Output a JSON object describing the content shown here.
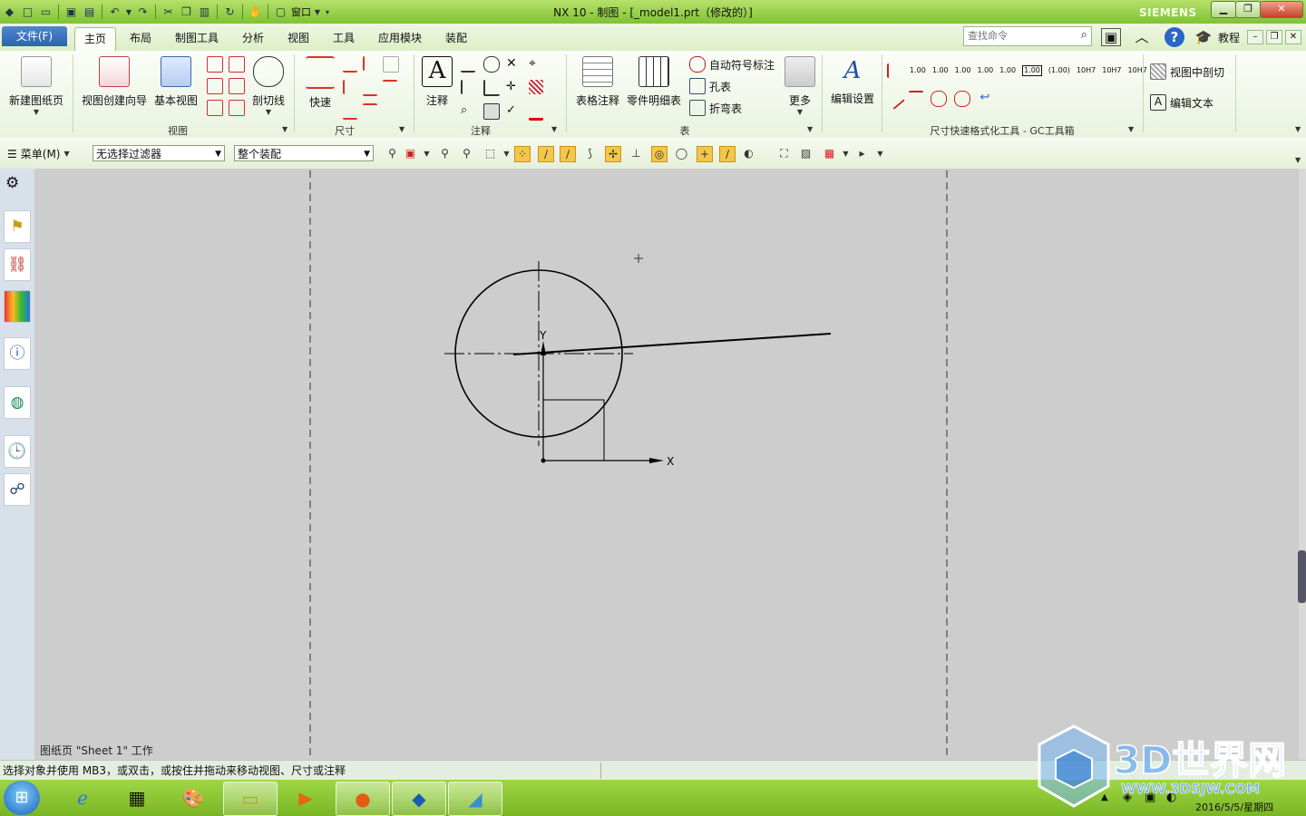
{
  "window": {
    "title": "NX 10 - 制图 - [_model1.prt（修改的）]",
    "brand": "SIEMENS",
    "qat_menu": "窗口"
  },
  "tabs": {
    "file": "文件(F)",
    "items": [
      "主页",
      "布局",
      "制图工具",
      "分析",
      "视图",
      "工具",
      "应用模块",
      "装配"
    ],
    "active": "主页",
    "search_placeholder": "查找命令",
    "tutorial": "教程"
  },
  "ribbon": {
    "new_sheet": "新建图纸页",
    "view_wizard": "视图创建向导",
    "base_view": "基本视图",
    "section_line": "剖切线",
    "group_view": "视图",
    "quick": "快速",
    "group_dimension": "尺寸",
    "note": "注释",
    "group_annotation": "注释",
    "table_note": "表格注释",
    "parts_list": "零件明细表",
    "auto_balloon": "自动符号标注",
    "hole_table": "孔表",
    "bend_table": "折弯表",
    "group_table": "表",
    "more": "更多",
    "edit_settings": "编辑设置",
    "gc_group": "尺寸快速格式化工具 - GC工具箱",
    "gc_numbers": [
      "1.00",
      "1.00",
      "1.00",
      "1.00",
      "1.00",
      "1.00",
      "(1.00)",
      "10H7",
      "10H7",
      "10H7",
      "10"
    ],
    "view_section": "视图中剖切",
    "edit_text": "编辑文本"
  },
  "toolbar2": {
    "menu": "菜单(M)",
    "filter": "无选择过滤器",
    "scope": "整个装配"
  },
  "canvas": {
    "axis_y": "Y",
    "axis_x": "X",
    "sheet_status": "图纸页 \"Sheet 1\" 工作"
  },
  "status": {
    "prompt": "选择对象并使用 MB3，或双击，或按住并拖动来移动视图、尺寸或注释"
  },
  "taskbar": {
    "clock": "2016/5/5/星期四"
  },
  "watermark": {
    "text": "3D世界网",
    "url": "WWW.3DSJW.COM"
  },
  "colors": {
    "titlebar": "#8cc63f",
    "file_tab": "#2d64b0",
    "canvas": "#cdcdcd"
  }
}
